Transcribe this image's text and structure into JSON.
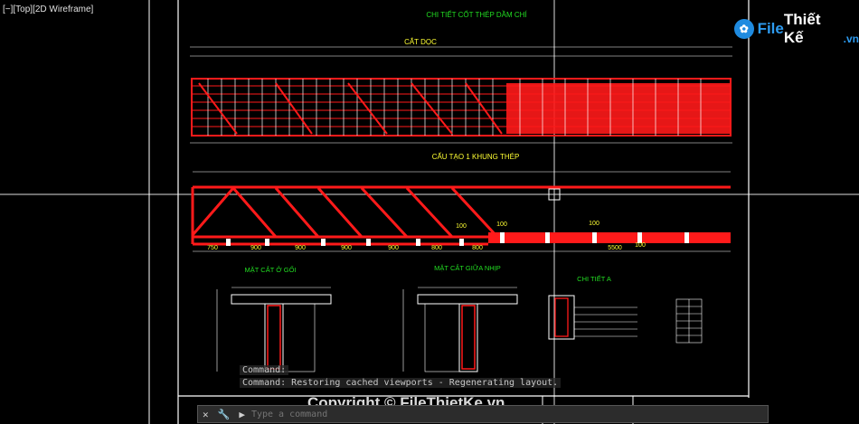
{
  "viewport_label": "[−][Top][2D Wireframe]",
  "drawing": {
    "title": "CHI TIẾT CỐT THÉP  DẦM CHÍ",
    "section_long": "CẮT DỌC",
    "frame_title": "CẤU TẠO 1 KHUNG THÉP",
    "frame_dims": [
      "750",
      "900",
      "900",
      "900",
      "900",
      "800",
      "800",
      "5500"
    ],
    "frame_marks": [
      "100",
      "100",
      "100",
      "100"
    ],
    "section_support": "MẶT CẮT Ở GỐI",
    "section_mid": "MẶT CẮT GIỮA NHỊP",
    "detail_a": "CHI TIẾT A"
  },
  "command": {
    "history_1": "Command:",
    "history_2": "Command: Restoring cached viewports - Regenerating layout.",
    "placeholder": "Type a command"
  },
  "logo": {
    "part1": "File",
    "part2": "Thiết Kế",
    "part3": ".vn"
  },
  "watermark": "Copyright © FileThietKe.vn",
  "colors": {
    "red": "#ff1a1a",
    "white": "#ffffff",
    "green": "#22dd22",
    "yellow": "#ffff33",
    "cyan": "#22dddd"
  }
}
